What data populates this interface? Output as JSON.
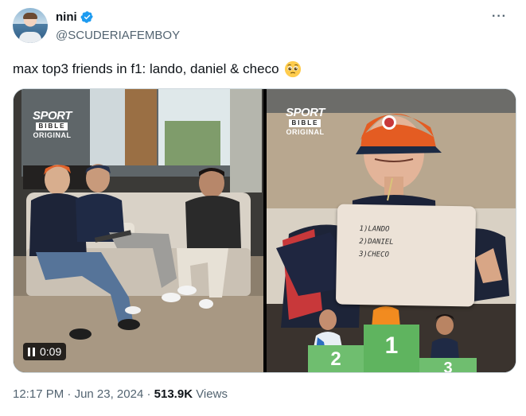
{
  "author": {
    "display_name": "nini",
    "handle": "@SCUDERIAFEMBOY",
    "verified": true,
    "avatar_icon": "avatar-photo"
  },
  "tweet": {
    "text": "max top3 friends in f1: lando, daniel & checo",
    "emoji": "pleading-face"
  },
  "media": {
    "left": {
      "logo": {
        "line1": "SPORT",
        "line2": "BIBLE",
        "line3": "ORIGINAL"
      },
      "video_time": "0:09",
      "control_icon": "pause-icon"
    },
    "right": {
      "logo": {
        "line1": "SPORT",
        "line2": "BIBLE",
        "line3": "ORIGINAL"
      },
      "card_lines": [
        "1)LANDO",
        "2)DANIEL",
        "3)CHECO"
      ],
      "podium": [
        "2",
        "1",
        "3"
      ]
    }
  },
  "footer": {
    "time": "12:17 PM",
    "date": "Jun 23, 2024",
    "views_count": "513.9K",
    "views_label": "Views"
  },
  "colors": {
    "verified_blue": "#1d9bf0",
    "podium_green": "#6fbe6f",
    "secondary_text": "#536471"
  }
}
